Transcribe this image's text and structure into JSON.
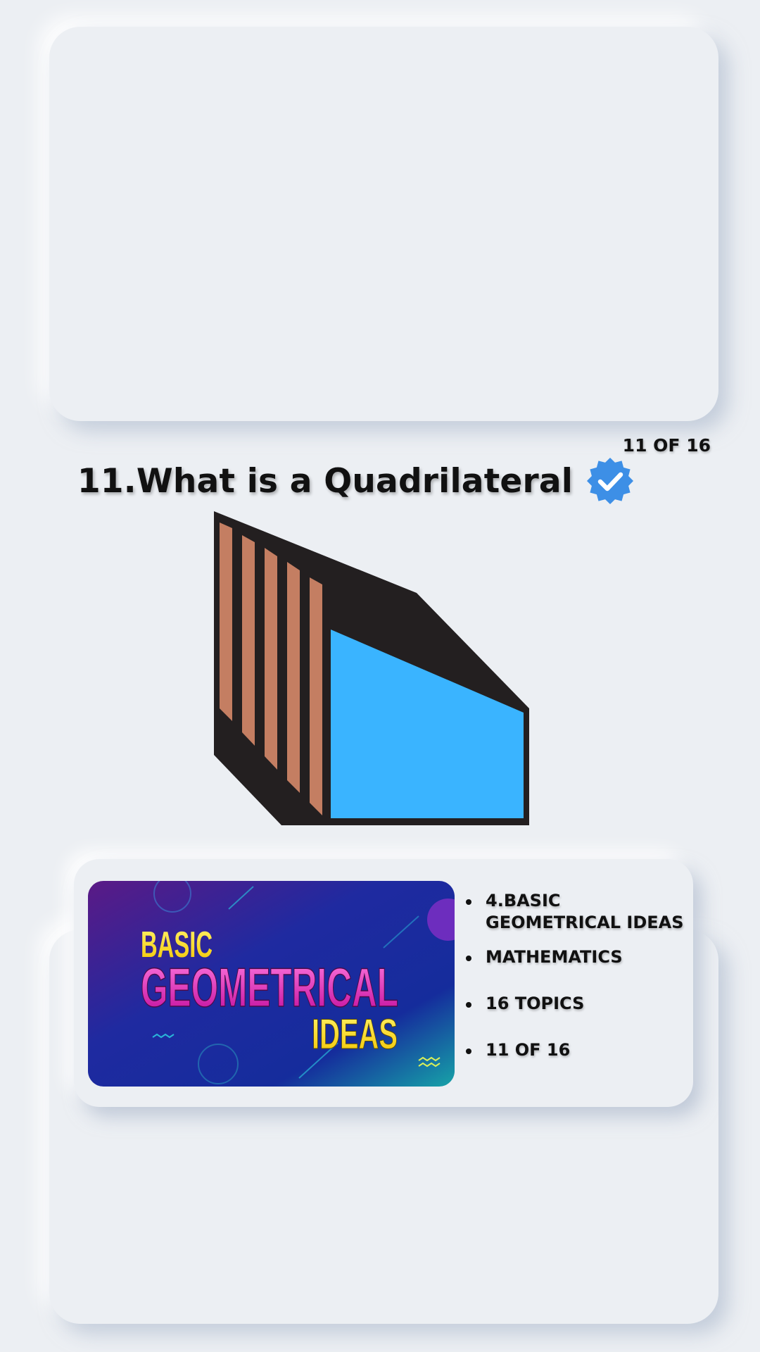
{
  "counter": "11 OF 16",
  "lesson": {
    "title": "11.What is a Quadrilateral"
  },
  "figure": {
    "front_color": "#3ab4ff",
    "stripe_color": "#c47e62",
    "outline_color": "#231f20"
  },
  "badge": {
    "icon": "verified-check-icon",
    "color": "#3d8fe6"
  },
  "course": {
    "thumbnail": {
      "line1": "BASIC",
      "line2": "GEOMETRICAL",
      "line3": "IDEAS"
    },
    "chapter": "4.BASIC GEOMETRICAL IDEAS",
    "subject": "MATHEMATICS",
    "topics": "16 TOPICS",
    "progress": "11 OF 16"
  }
}
